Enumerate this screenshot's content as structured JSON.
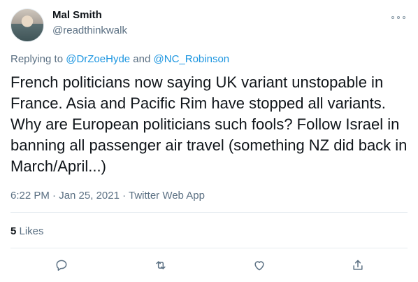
{
  "tweet": {
    "author_name": "Mal Smith",
    "author_handle": "@readthinkwalk",
    "replying_prefix": "Replying to ",
    "reply_user_1": "@DrZoeHyde",
    "reply_conjunction": " and ",
    "reply_user_2": "@NC_Robinson",
    "text": "French politicians now saying UK variant unstopable in France. Asia and Pacific Rim have stopped all variants. Why are European politicians such fools? Follow Israel in banning all passenger air travel (something NZ did back in March/April...)",
    "timestamp": "6:22 PM · Jan 25, 2021 · Twitter Web App",
    "likes_count": "5",
    "likes_label": " Likes"
  },
  "actions": {
    "reply_icon": "reply-icon",
    "retweet_icon": "retweet-icon",
    "like_icon": "heart-icon",
    "share_icon": "share-icon"
  },
  "colors": {
    "text": "#0f1419",
    "muted": "#5b7083",
    "link": "#1b95e0",
    "divider": "#e6ecf0"
  }
}
